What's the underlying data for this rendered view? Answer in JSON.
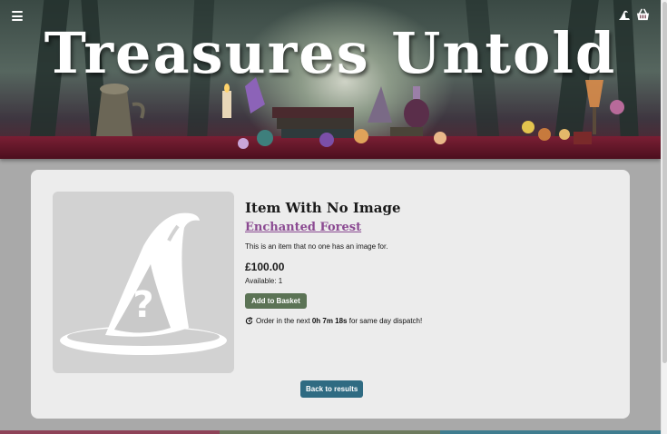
{
  "header": {
    "title": "Treasures Untold",
    "menu_icon": "hamburger-menu-icon",
    "account_icon": "wizard-hat-account-icon",
    "basket_icon": "basket-icon"
  },
  "product": {
    "title": "Item With No Image",
    "collection": "Enchanted Forest",
    "description": "This is an item that no one has an image for.",
    "price": "£100.00",
    "availability": "Available: 1",
    "add_to_basket_label": "Add to Basket",
    "dispatch": {
      "prefix": "Order in the next ",
      "countdown": "0h 7m 18s",
      "suffix": " for same day dispatch!"
    },
    "image_placeholder_icon": "wizard-hat-question-icon"
  },
  "back_label": "Back to results",
  "colors": {
    "accent_link": "#8b4a92",
    "add_button": "#5b7355",
    "back_button": "#2f6b82",
    "strip_red": "#8e4358",
    "strip_green": "#6e7b5e",
    "strip_teal": "#3f7d8f"
  }
}
